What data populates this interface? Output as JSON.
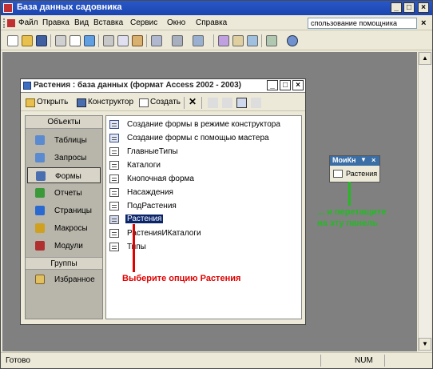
{
  "app": {
    "title": "База данных садовника",
    "window_controls": {
      "minimize": "_",
      "maximize": "□",
      "close": "×"
    }
  },
  "menu": {
    "items": [
      "Файл",
      "Правка",
      "Вид",
      "Вставка",
      "Сервис",
      "Окно",
      "Справка"
    ],
    "help_box": "спользование помощника",
    "close": "×"
  },
  "toolbar": {
    "icons": [
      "new-icon",
      "open-icon",
      "save-icon",
      "print-icon",
      "preview-icon",
      "spell-icon",
      "cut-icon",
      "copy-icon",
      "paste-icon",
      "undo-icon",
      "links-icon",
      "analyze-icon",
      "code-icon",
      "properties-icon",
      "relationships-icon",
      "new-object-icon",
      "help-icon"
    ]
  },
  "dbwindow": {
    "title": "Растения : база данных (формат Access 2002 - 2003)",
    "toolbar": {
      "open": "Открыть",
      "design": "Конструктор",
      "create": "Создать"
    },
    "objects_header": "Объекты",
    "groups_header": "Группы",
    "objects": [
      {
        "label": "Таблицы",
        "icon": "table-icon",
        "color": "#5a8ad0"
      },
      {
        "label": "Запросы",
        "icon": "query-icon",
        "color": "#5a8ad0"
      },
      {
        "label": "Формы",
        "icon": "form-icon",
        "color": "#4a6fb0",
        "selected": true
      },
      {
        "label": "Отчеты",
        "icon": "report-icon",
        "color": "#3a9a3a"
      },
      {
        "label": "Страницы",
        "icon": "page-icon",
        "color": "#2a6ad0"
      },
      {
        "label": "Макросы",
        "icon": "macro-icon",
        "color": "#d0a020"
      },
      {
        "label": "Модули",
        "icon": "module-icon",
        "color": "#b03030"
      }
    ],
    "favorites": {
      "label": "Избранное",
      "icon": "favorites-icon"
    },
    "list": [
      {
        "label": "Создание формы в режиме конструктора",
        "wizard": true
      },
      {
        "label": "Создание формы с помощью мастера",
        "wizard": true
      },
      {
        "label": "ГлавныеТипы"
      },
      {
        "label": "Каталоги"
      },
      {
        "label": "Кнопочная форма"
      },
      {
        "label": "Насаждения"
      },
      {
        "label": "ПодРастения"
      },
      {
        "label": "Растения",
        "selected": true
      },
      {
        "label": "РастенияИКаталоги"
      },
      {
        "label": "Типы"
      }
    ]
  },
  "mypanel": {
    "title": "МоиКн",
    "close": "×",
    "item": "Растения"
  },
  "annotations": {
    "red": "Выберите опцию Растения",
    "green_line1": "... и перетащите",
    "green_line2": "на эту панель"
  },
  "status": {
    "text": "Готово",
    "num": "NUM"
  },
  "colors": {
    "title_blue": "#1b45b0",
    "selection": "#0a246a",
    "annotation_red": "#e00000",
    "annotation_green": "#22bb22"
  }
}
